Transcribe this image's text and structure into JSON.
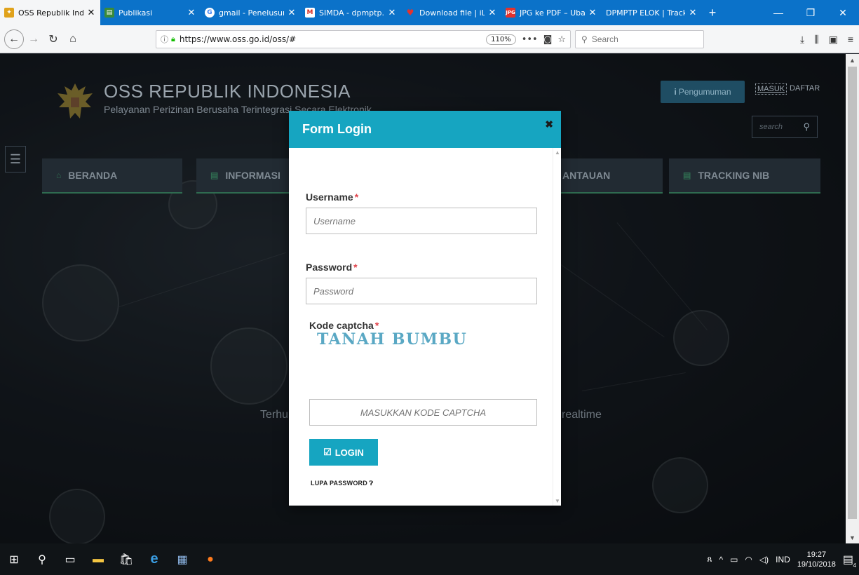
{
  "browser": {
    "tabs": [
      {
        "title": "OSS Republik Indone",
        "favicon_color": "#e0a21b",
        "active": true
      },
      {
        "title": "Publikasi",
        "favicon_color": "#3a8a3a",
        "active": false
      },
      {
        "title": "gmail - Penelusuran",
        "favicon_color": "#4285f4",
        "active": false
      },
      {
        "title": "SIMDA - dpmptp.p",
        "favicon_color": "#d93025",
        "active": false
      },
      {
        "title": "Download file | iLov",
        "favicon_color": "#e5322d",
        "active": false
      },
      {
        "title": "JPG ke PDF – Ubah",
        "favicon_color": "#e5322d",
        "active": false
      },
      {
        "title": "DPMPTP ELOK | Trackin",
        "favicon_color": "#0b72c9",
        "active": false
      }
    ],
    "url": "https://www.oss.go.id/oss/#",
    "zoom": "110%",
    "search_placeholder": "Search"
  },
  "site": {
    "title": "OSS REPUBLIK INDONESIA",
    "subtitle": "Pelayanan Perizinan Berusaha Terintegrasi Secara Elektronik",
    "pengumuman": "Pengumuman",
    "masuk": "MASUK",
    "daftar": "DAFTAR",
    "search_placeholder": "search",
    "menu": [
      {
        "label": "BERANDA"
      },
      {
        "label": "INFORMASI"
      },
      {
        "label": "ANTAUAN"
      },
      {
        "label": "TRACKING NIB"
      }
    ],
    "bg_text_left": "Terhu",
    "bg_text_right": "realtime"
  },
  "modal": {
    "title": "Form Login",
    "username_label": "Username",
    "username_placeholder": "Username",
    "password_label": "Password",
    "password_placeholder": "Password",
    "captcha_label": "Kode captcha",
    "required_mark": "*",
    "captcha_text": "TANAH BUMBU",
    "captcha_placeholder": "MASUKKAN KODE CAPTCHA",
    "login_label": "LOGIN",
    "forgot_label": "LUPA PASSWORD"
  },
  "taskbar": {
    "language": "IND",
    "time": "19:27",
    "date": "19/10/2018",
    "notifications": "4"
  }
}
